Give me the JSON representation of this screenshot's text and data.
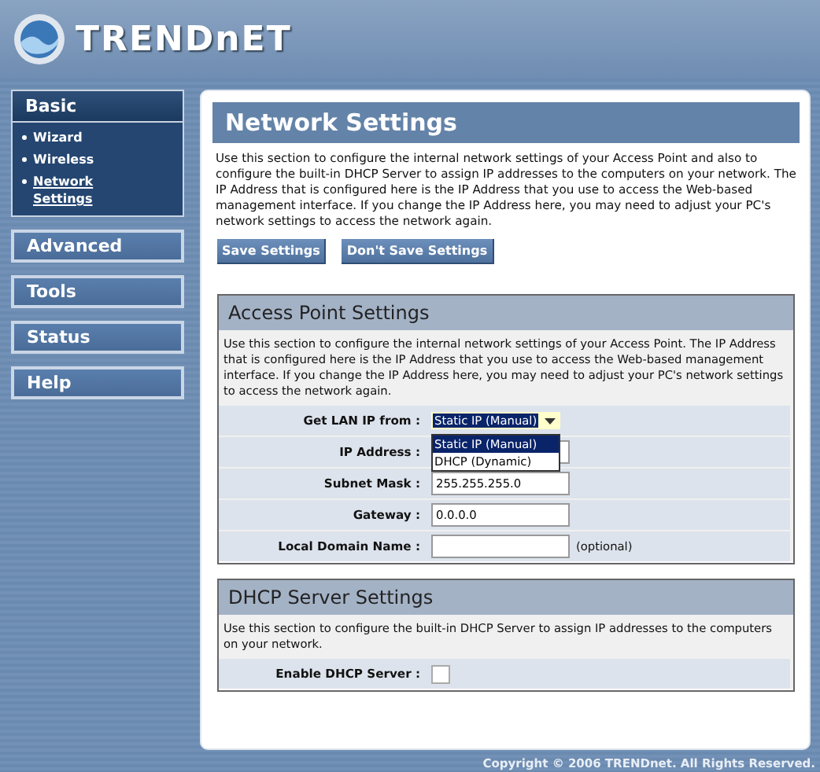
{
  "logo": {
    "text": "TRENDnET"
  },
  "sidebar": {
    "menus": [
      {
        "label": "Basic",
        "expanded": true,
        "children": [
          {
            "label": "Wizard",
            "selected": false
          },
          {
            "label": "Wireless",
            "selected": false
          },
          {
            "label": "Network Settings",
            "selected": true
          }
        ]
      },
      {
        "label": "Advanced",
        "expanded": false
      },
      {
        "label": "Tools",
        "expanded": false
      },
      {
        "label": "Status",
        "expanded": false
      },
      {
        "label": "Help",
        "expanded": false
      }
    ]
  },
  "page": {
    "title": "Network Settings",
    "intro": "Use this section to configure the internal network settings of your Access Point and also to configure the built-in DHCP Server to assign IP addresses to the computers on your network. The IP Address that is configured here is the IP Address that you use to access the Web-based management interface. If you change the IP Address here, you may need to adjust your PC's network settings to access the network again.",
    "buttons": [
      "Save Settings",
      "Don't Save Settings"
    ],
    "sections": [
      {
        "title": "Access Point Settings",
        "description": "Use this section to configure the internal network settings of your Access Point. The IP Address that is configured here is the IP Address that you use to access the Web-based management interface. If you change the IP Address here, you may need to adjust your PC's network settings to access the network again.",
        "fields": [
          {
            "kind": "select",
            "label": "Get LAN IP from :",
            "value": "Static IP (Manual)",
            "open": true,
            "options": [
              {
                "label": "Static IP (Manual)",
                "selected": true
              },
              {
                "label": "DHCP (Dynamic)",
                "selected": false
              }
            ]
          },
          {
            "kind": "text",
            "label": "IP Address :"
          },
          {
            "kind": "text",
            "label": "Subnet Mask :",
            "value": "255.255.255.0"
          },
          {
            "kind": "text",
            "label": "Gateway :",
            "value": "0.0.0.0"
          },
          {
            "kind": "text",
            "label": "Local Domain Name :",
            "note": "(optional)"
          }
        ]
      },
      {
        "title": "DHCP Server Settings",
        "description": "Use this section to configure the built-in DHCP Server to assign IP addresses to the computers on your network.",
        "fields": [
          {
            "kind": "checkbox",
            "label": "Enable DHCP Server :",
            "checked": false
          }
        ]
      }
    ]
  },
  "footer": {
    "copyright": "Copyright © 2006 TRENDnet. All Rights Reserved."
  }
}
